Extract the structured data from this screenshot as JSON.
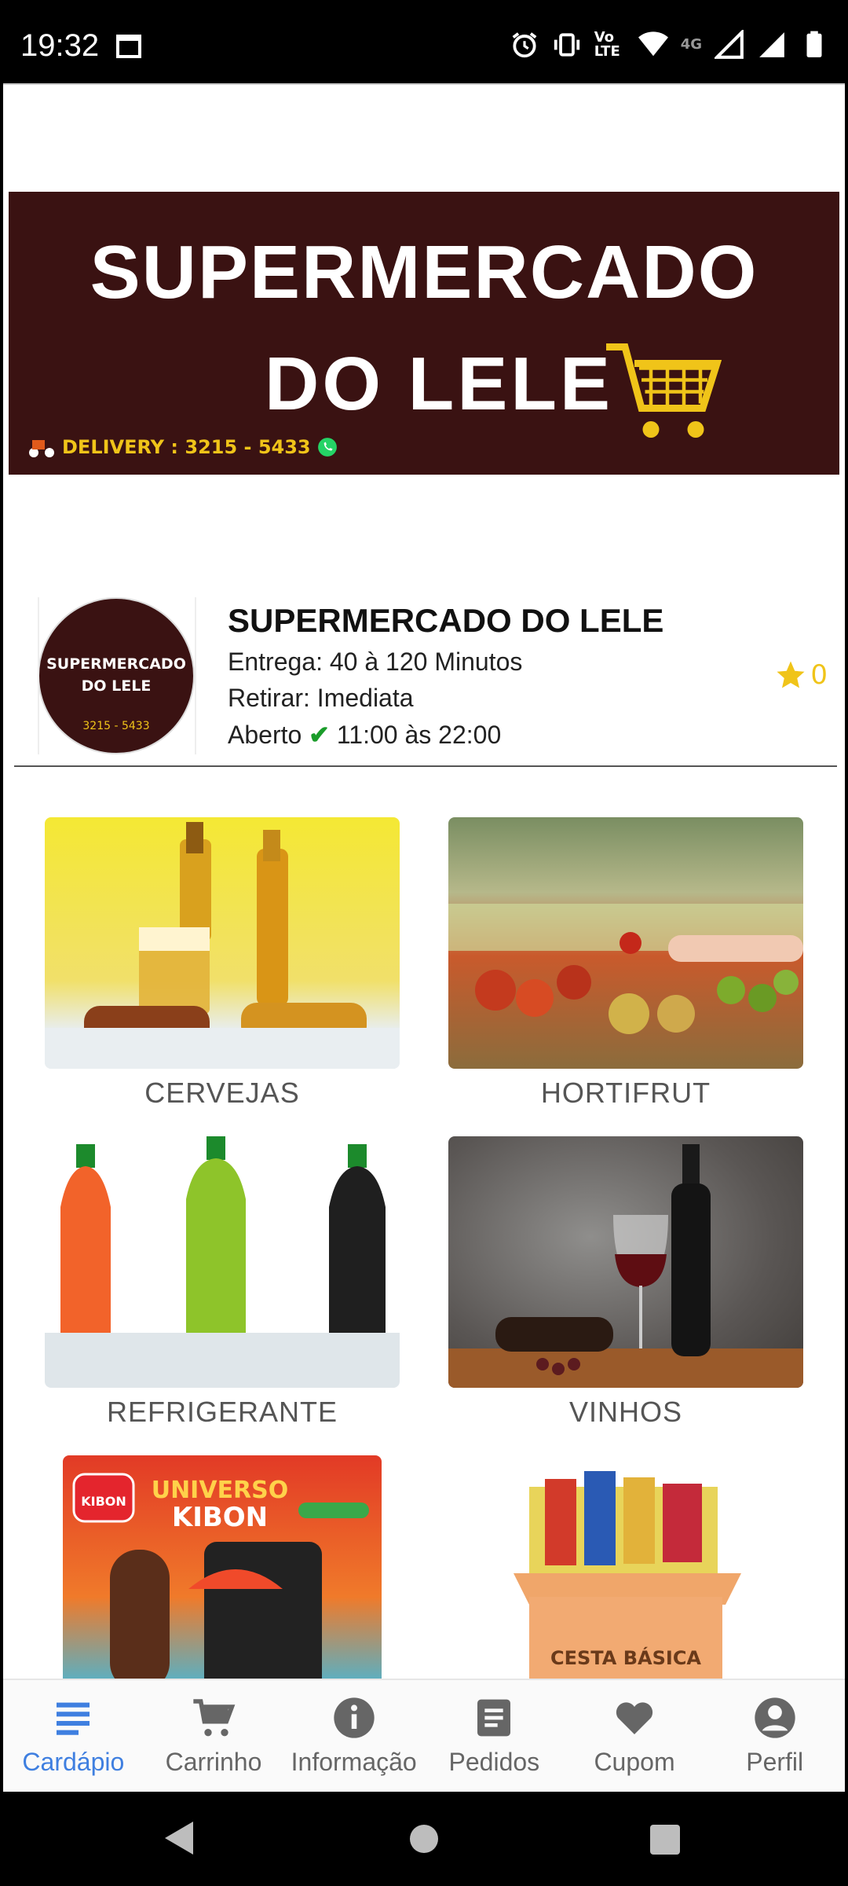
{
  "status_bar": {
    "time": "19:32",
    "network_label": "4G",
    "volte_label": "Vo LTE"
  },
  "banner": {
    "line1": "SUPERMERCADO",
    "line2": "DO LELE",
    "delivery": "DELIVERY : 3215 - 5433"
  },
  "store": {
    "logo_line1": "SUPERMERCADO",
    "logo_line2": "DO LELE",
    "logo_phone": "3215 - 5433",
    "name": "SUPERMERCADO DO LELE",
    "delivery_time": "Entrega: 40 à 120 Minutos",
    "pickup": "Retirar: Imediata",
    "open_label": "Aberto",
    "hours": "11:00 às 22:00",
    "rating": "0"
  },
  "categories": [
    {
      "label": "CERVEJAS"
    },
    {
      "label": "HORTIFRUT"
    },
    {
      "label": "REFRIGERANTE"
    },
    {
      "label": "VINHOS"
    },
    {
      "label": "",
      "image_text_1": "UNIVERSO",
      "image_text_2": "KIBON",
      "image_text_3": "KIBON"
    },
    {
      "label": "",
      "image_text_1": "CESTA BÁSICA"
    }
  ],
  "nav": {
    "items": [
      {
        "label": "Cardápio",
        "icon": "menu-icon",
        "active": true
      },
      {
        "label": "Carrinho",
        "icon": "cart-icon"
      },
      {
        "label": "Informação",
        "icon": "info-icon"
      },
      {
        "label": "Pedidos",
        "icon": "orders-icon"
      },
      {
        "label": "Cupom",
        "icon": "heart-icon"
      },
      {
        "label": "Perfil",
        "icon": "profile-icon"
      }
    ]
  },
  "colors": {
    "accent": "#3f7fe0",
    "banner_bg": "#3a1212",
    "star": "#f0c419",
    "open_check": "#1a9c2a"
  }
}
